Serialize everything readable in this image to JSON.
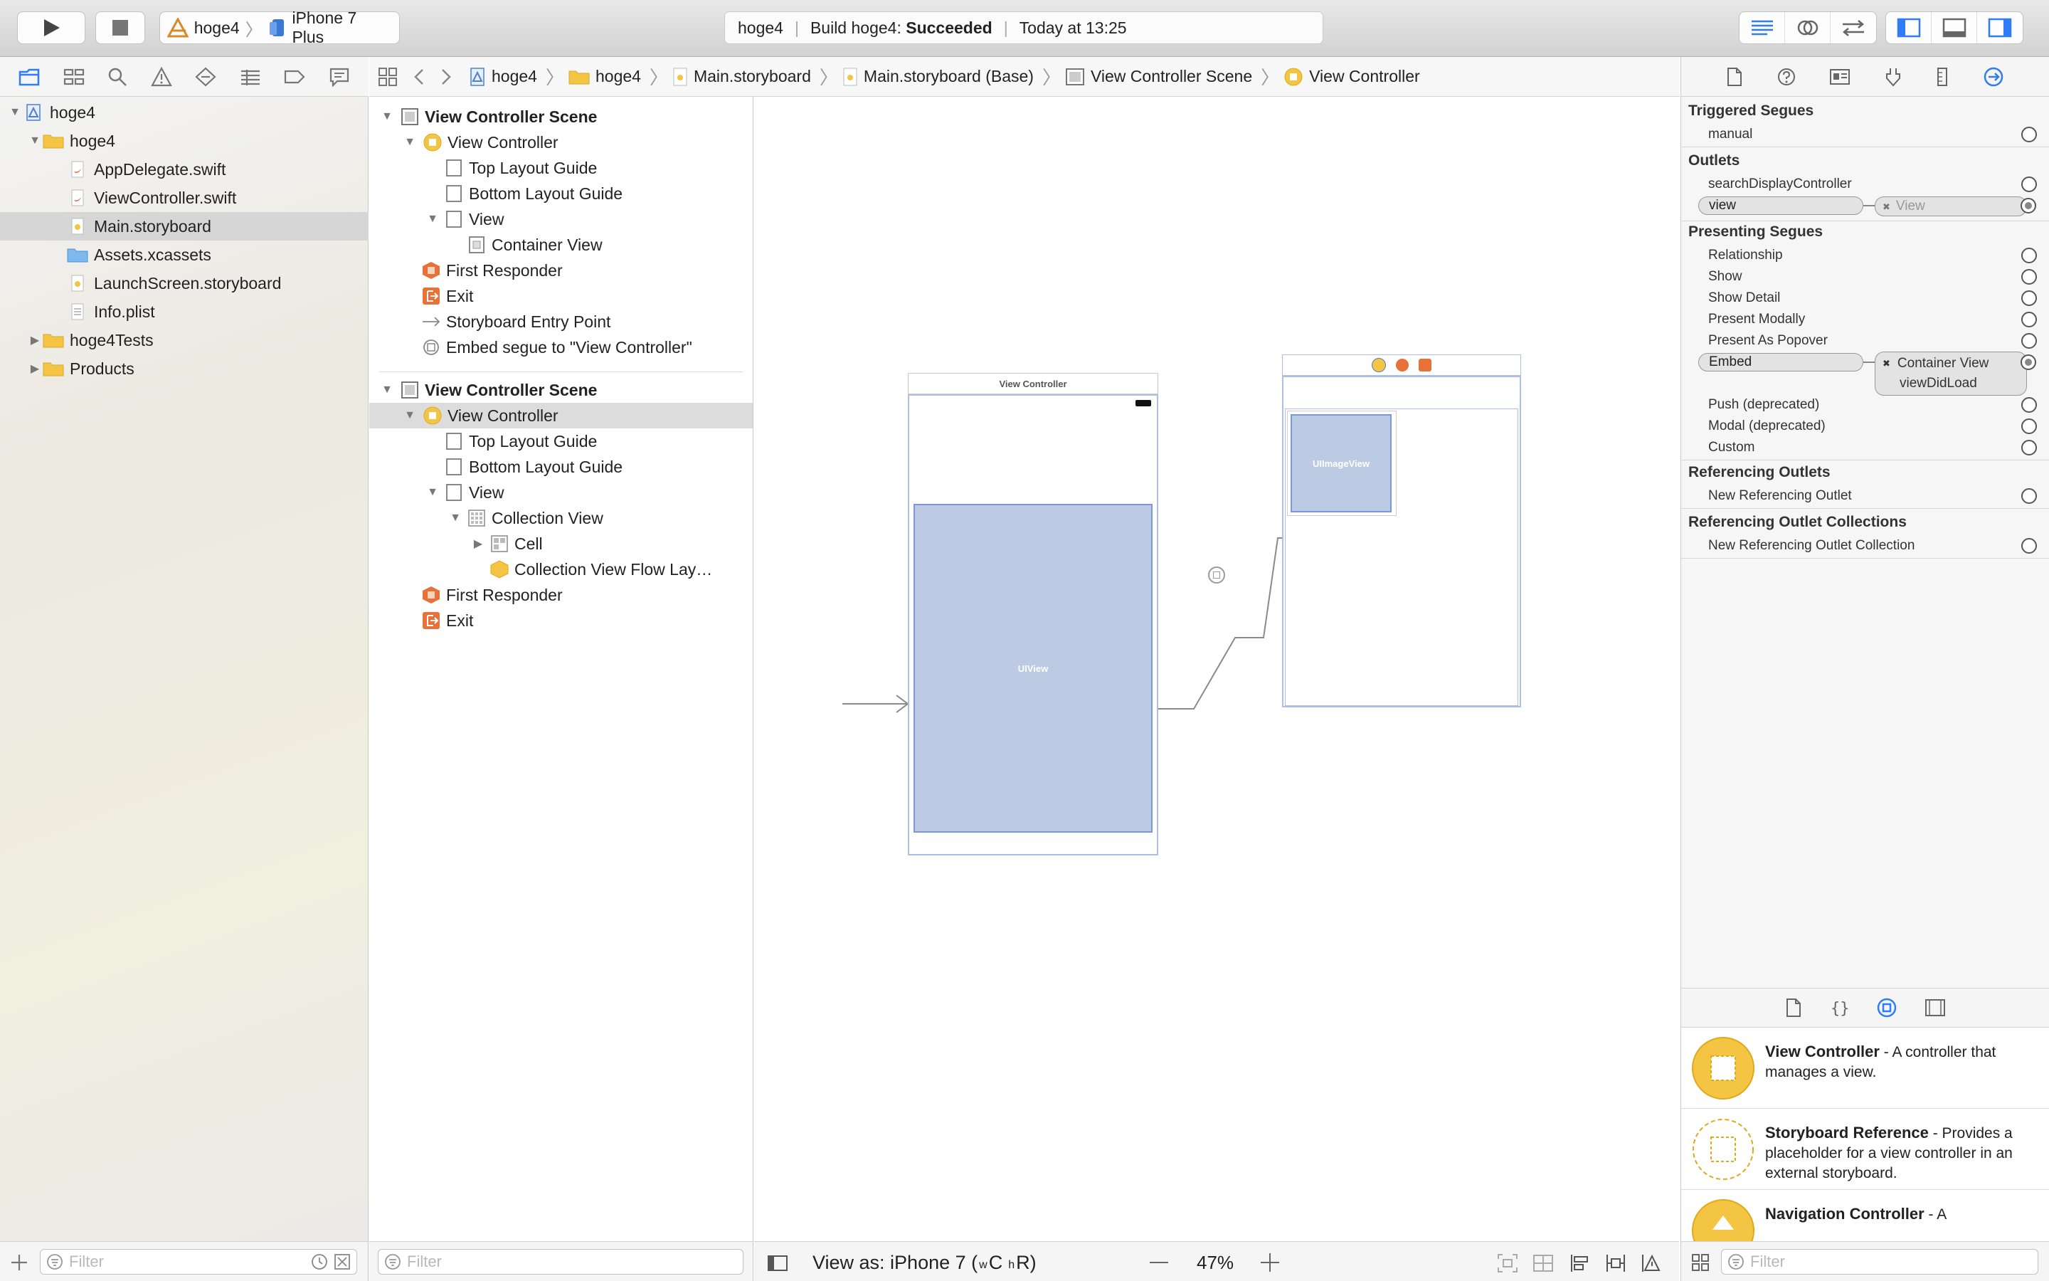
{
  "toolbar": {
    "scheme_target": "hoge4",
    "scheme_device": "iPhone 7 Plus",
    "activity_project": "hoge4",
    "activity_build_prefix": "Build hoge4: ",
    "activity_build_status": "Succeeded",
    "activity_time": "Today at 13:25"
  },
  "navigator": {
    "items": [
      {
        "label": "hoge4",
        "icon": "project-icon"
      },
      {
        "label": "hoge4",
        "icon": "folder-icon"
      },
      {
        "label": "AppDelegate.swift",
        "icon": "swift-file-icon"
      },
      {
        "label": "ViewController.swift",
        "icon": "swift-file-icon"
      },
      {
        "label": "Main.storyboard",
        "icon": "storyboard-file-icon"
      },
      {
        "label": "Assets.xcassets",
        "icon": "assets-folder-icon"
      },
      {
        "label": "LaunchScreen.storyboard",
        "icon": "storyboard-file-icon"
      },
      {
        "label": "Info.plist",
        "icon": "plist-file-icon"
      },
      {
        "label": "hoge4Tests",
        "icon": "folder-icon"
      },
      {
        "label": "Products",
        "icon": "folder-icon"
      }
    ],
    "filter_placeholder": "Filter"
  },
  "jumpbar": {
    "crumbs": [
      "hoge4",
      "hoge4",
      "Main.storyboard",
      "Main.storyboard (Base)",
      "View Controller Scene",
      "View Controller"
    ]
  },
  "outline": {
    "rows": [
      "View Controller Scene",
      "View Controller",
      "Top Layout Guide",
      "Bottom Layout Guide",
      "View",
      "Container View",
      "First Responder",
      "Exit",
      "Storyboard Entry Point",
      "Embed segue to \"View Controller\"",
      "View Controller Scene",
      "View Controller",
      "Top Layout Guide",
      "Bottom Layout Guide",
      "View",
      "Collection View",
      "Cell",
      "Collection View Flow Lay…",
      "First Responder",
      "Exit"
    ],
    "filter_placeholder": "Filter"
  },
  "canvas": {
    "scene1_title": "View Controller",
    "uiview_label": "UIView",
    "uiimageview_label": "UIImageView"
  },
  "canvasbar": {
    "view_as_prefix": "View as: iPhone 7 (",
    "w": "w",
    "c": "C",
    "h": "h",
    "r": "R)",
    "zoom": "47%"
  },
  "inspector": {
    "triggered_segues": "Triggered Segues",
    "manual": "manual",
    "outlets": "Outlets",
    "search_display_controller": "searchDisplayController",
    "view": "view",
    "view_target": "View",
    "presenting_segues": "Presenting Segues",
    "relationship": "Relationship",
    "show": "Show",
    "show_detail": "Show Detail",
    "present_modally": "Present Modally",
    "present_as_popover": "Present As Popover",
    "embed": "Embed",
    "embed_target_1": "Container View",
    "embed_target_2": "viewDidLoad",
    "push": "Push (deprecated)",
    "modal": "Modal (deprecated)",
    "custom": "Custom",
    "referencing_outlets": "Referencing Outlets",
    "new_referencing_outlet": "New Referencing Outlet",
    "referencing_outlet_collections": "Referencing Outlet Collections",
    "new_referencing_outlet_collection": "New Referencing Outlet Collection"
  },
  "library": {
    "items": [
      {
        "title": "View Controller",
        "desc": " - A controller that manages a view."
      },
      {
        "title": "Storyboard Reference",
        "desc": " - Provides a placeholder for a view controller in an external storyboard."
      },
      {
        "title": "Navigation Controller",
        "desc": " - A"
      }
    ],
    "filter_placeholder": "Filter"
  },
  "colors": {
    "accent": "#2f7cf6",
    "selection": "#d6d6d6",
    "scene_fill": "#bccbe3",
    "folder": "#f4c542"
  }
}
